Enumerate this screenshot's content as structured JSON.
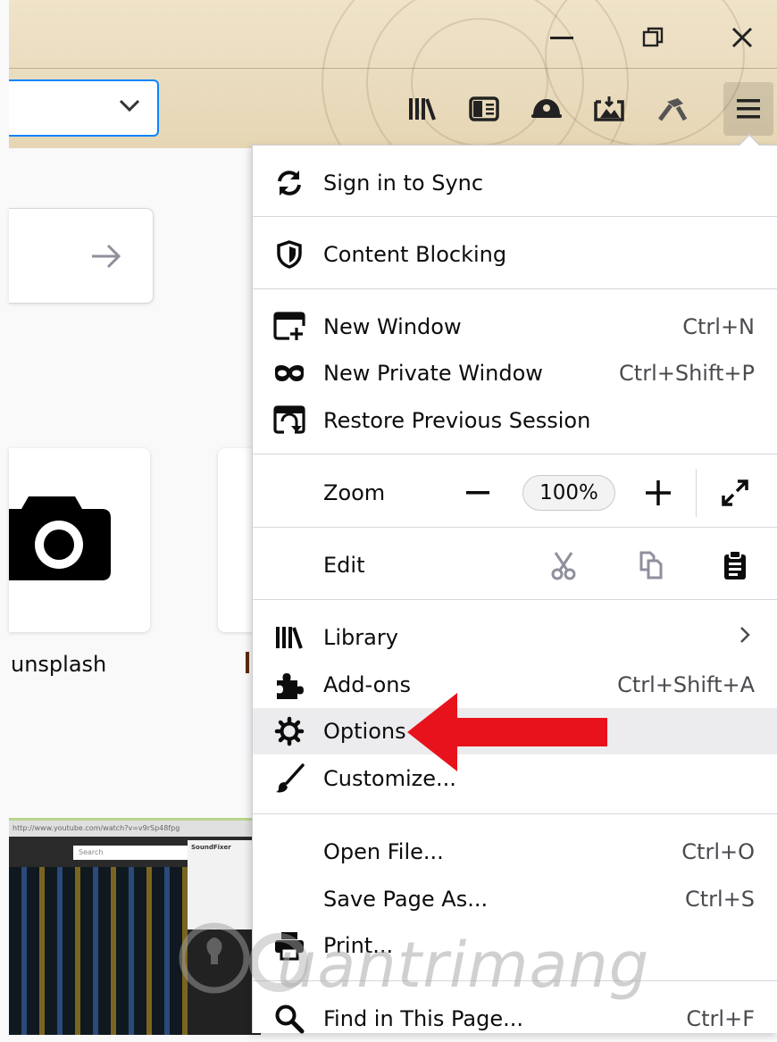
{
  "window_controls": {
    "minimize": "minimize-icon",
    "restore": "restore-icon",
    "close": "close-icon"
  },
  "toolbar": {
    "icons": [
      "library-icon",
      "sidebar-icon",
      "extension-icon",
      "screenshot-icon",
      "tool-icon",
      "hamburger-menu-icon"
    ]
  },
  "content": {
    "tiles": [
      {
        "label": "unsplash",
        "icon": "camera-icon"
      }
    ],
    "thumbnail": {
      "url": "http://www.youtube.com/watch?v=v9rSp48fpg",
      "search_placeholder": "Search",
      "panel_title": "SoundFixer"
    }
  },
  "menu": {
    "items": {
      "sign_in": {
        "label": "Sign in to Sync",
        "icon": "sync-icon"
      },
      "content_blocking": {
        "label": "Content Blocking",
        "icon": "shield-icon"
      },
      "new_window": {
        "label": "New Window",
        "shortcut": "Ctrl+N",
        "icon": "new-window-icon"
      },
      "new_private_window": {
        "label": "New Private Window",
        "shortcut": "Ctrl+Shift+P",
        "icon": "private-mask-icon"
      },
      "restore_session": {
        "label": "Restore Previous Session",
        "icon": "restore-session-icon"
      },
      "zoom": {
        "label": "Zoom",
        "value": "100%"
      },
      "edit": {
        "label": "Edit"
      },
      "library": {
        "label": "Library",
        "icon": "library-icon"
      },
      "addons": {
        "label": "Add-ons",
        "shortcut": "Ctrl+Shift+A",
        "icon": "puzzle-icon"
      },
      "options": {
        "label": "Options",
        "icon": "gear-icon"
      },
      "customize": {
        "label": "Customize...",
        "icon": "paintbrush-icon"
      },
      "open_file": {
        "label": "Open File...",
        "shortcut": "Ctrl+O"
      },
      "save_page": {
        "label": "Save Page As...",
        "shortcut": "Ctrl+S"
      },
      "print": {
        "label": "Print...",
        "icon": "printer-icon"
      },
      "find": {
        "label": "Find in This Page...",
        "shortcut": "Ctrl+F",
        "icon": "search-icon"
      }
    }
  },
  "annotation": {
    "color": "#e8121c"
  },
  "watermark": {
    "text": "uantrimang"
  },
  "colors": {
    "accent": "#0a84ff",
    "highlight": "#ececee"
  }
}
